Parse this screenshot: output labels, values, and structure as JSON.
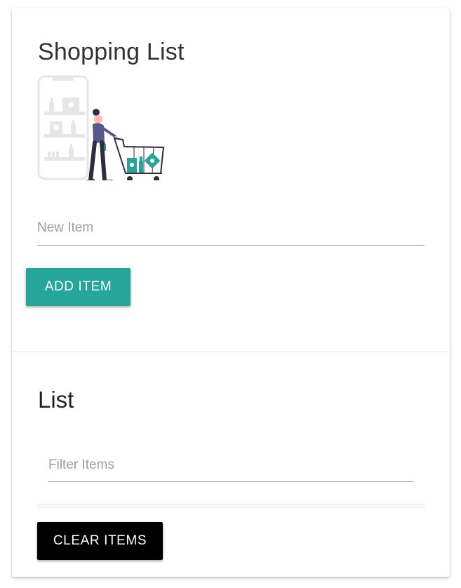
{
  "header": {
    "title": "Shopping List"
  },
  "illustration": {
    "icon": "shopping-cart-illustration",
    "accent_color": "#26a69a"
  },
  "new_item": {
    "placeholder": "New Item",
    "value": ""
  },
  "add_button": {
    "label": "ADD ITEM",
    "color": "#26a69a"
  },
  "list": {
    "title": "List",
    "filter_placeholder": "Filter Items",
    "filter_value": "",
    "items": []
  },
  "clear_button": {
    "label": "CLEAR ITEMS",
    "color": "#000000"
  }
}
